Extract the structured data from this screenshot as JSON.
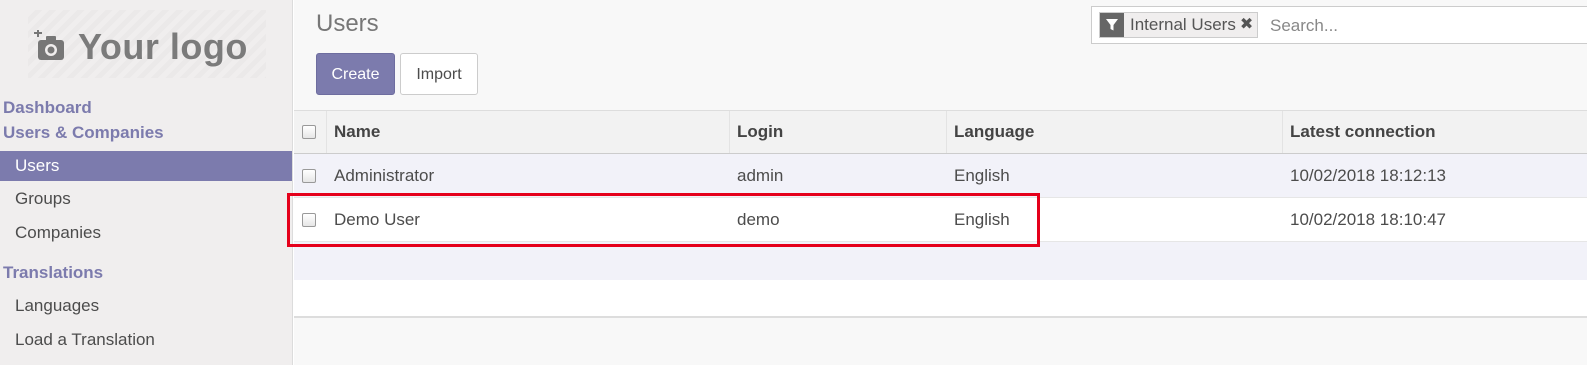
{
  "sidebar": {
    "logo_text": "Your logo",
    "sections": [
      {
        "label": "Dashboard"
      },
      {
        "label": "Users & Companies"
      },
      {
        "label": "Translations"
      }
    ],
    "items": [
      {
        "label": "Users",
        "active": true
      },
      {
        "label": "Groups"
      },
      {
        "label": "Companies"
      },
      {
        "label": "Languages"
      },
      {
        "label": "Load a Translation"
      }
    ]
  },
  "control_panel": {
    "title": "Users",
    "create_label": "Create",
    "import_label": "Import"
  },
  "search": {
    "facet_label": "Internal Users",
    "facet_icon": "filter-icon",
    "remove_icon": "close-icon",
    "placeholder": "Search..."
  },
  "table": {
    "columns": [
      "Name",
      "Login",
      "Language",
      "Latest connection"
    ],
    "rows": [
      {
        "name": "Administrator",
        "login": "admin",
        "language": "English",
        "latest_connection": "10/02/2018 18:12:13"
      },
      {
        "name": "Demo User",
        "login": "demo",
        "language": "English",
        "latest_connection": "10/02/2018 18:10:47"
      }
    ]
  },
  "colors": {
    "accent": "#7c7bad",
    "highlight": "#e5001b"
  }
}
